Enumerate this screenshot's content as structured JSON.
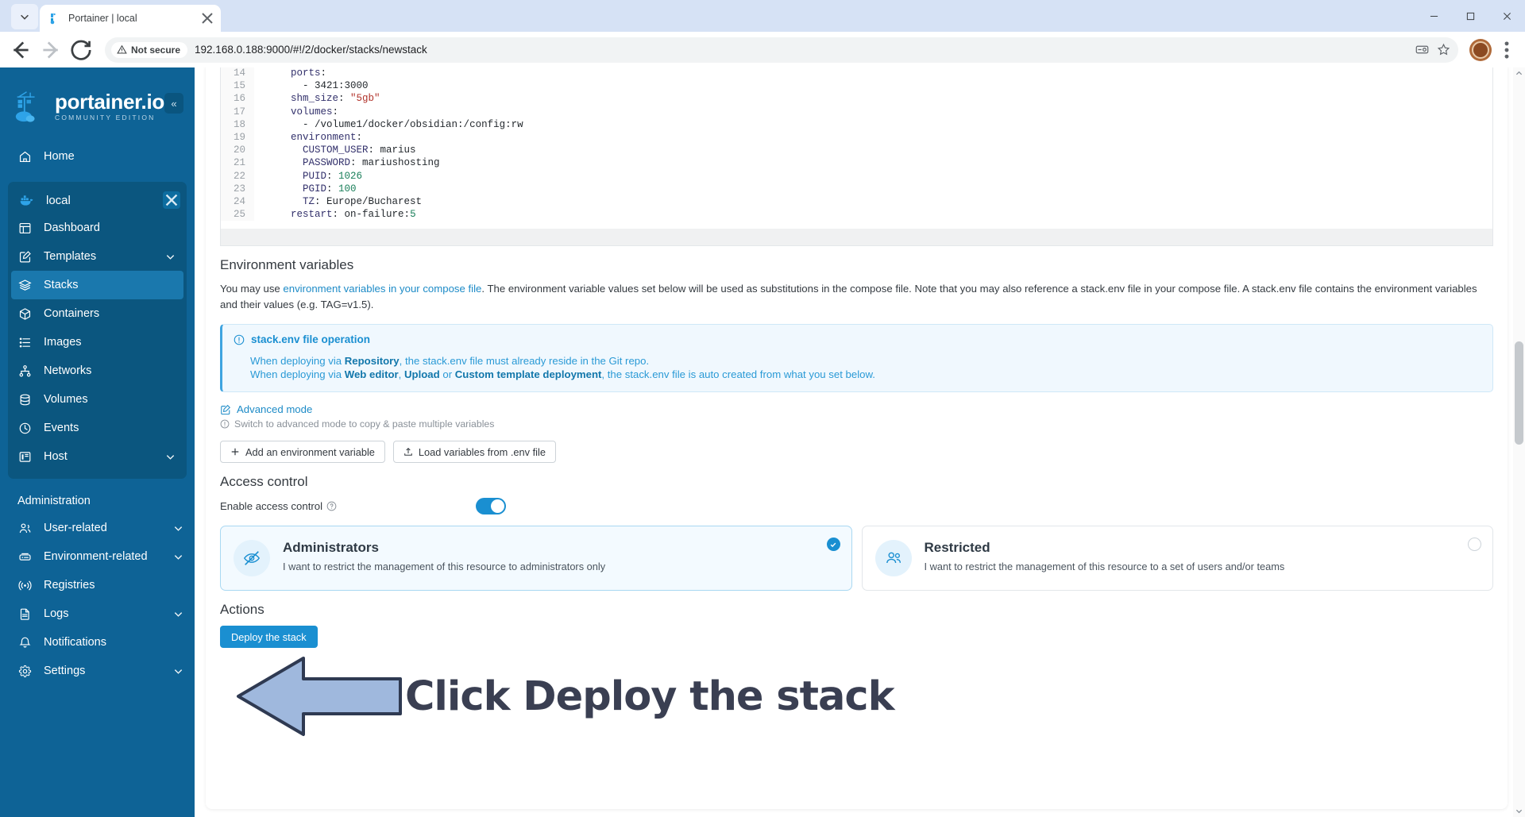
{
  "browser": {
    "tab": {
      "title": "Portainer | local",
      "favicon_icon": "portainer-favicon",
      "close_icon": "close-icon"
    },
    "tab_search_icon": "chevron-down-icon",
    "window_controls": {
      "minimize": "minimize-icon",
      "maximize": "maximize-icon",
      "close": "close-icon"
    },
    "nav": {
      "back_icon": "back-arrow-icon",
      "forward_icon": "forward-arrow-icon",
      "reload_icon": "reload-icon"
    },
    "security_label": "Not secure",
    "security_icon": "warning-triangle-icon",
    "url": "192.168.0.188:9000/#!/2/docker/stacks/newstack",
    "omnibox_icons": [
      "payment-card-icon",
      "bookmark-star-icon"
    ],
    "profile_icon": "avatar",
    "menu_icon": "kebab-menu-icon"
  },
  "sidebar": {
    "logo": {
      "name": "portainer.io",
      "edition": "COMMUNITY EDITION"
    },
    "collapse_label": "«",
    "home": {
      "label": "Home",
      "icon": "home-icon"
    },
    "environment": {
      "name": "local",
      "icon": "docker-whale-icon",
      "close_icon": "close-icon",
      "items": [
        {
          "label": "Dashboard",
          "icon": "dashboard-icon",
          "chevron": false,
          "active": false
        },
        {
          "label": "Templates",
          "icon": "templates-icon",
          "chevron": true,
          "active": false
        },
        {
          "label": "Stacks",
          "icon": "stacks-icon",
          "chevron": false,
          "active": true
        },
        {
          "label": "Containers",
          "icon": "containers-icon",
          "chevron": false,
          "active": false
        },
        {
          "label": "Images",
          "icon": "images-icon",
          "chevron": false,
          "active": false
        },
        {
          "label": "Networks",
          "icon": "networks-icon",
          "chevron": false,
          "active": false
        },
        {
          "label": "Volumes",
          "icon": "volumes-icon",
          "chevron": false,
          "active": false
        },
        {
          "label": "Events",
          "icon": "events-clock-icon",
          "chevron": false,
          "active": false
        },
        {
          "label": "Host",
          "icon": "host-icon",
          "chevron": true,
          "active": false
        }
      ]
    },
    "administration": {
      "title": "Administration",
      "items": [
        {
          "label": "User-related",
          "icon": "users-icon",
          "chevron": true
        },
        {
          "label": "Environment-related",
          "icon": "environment-icon",
          "chevron": true
        },
        {
          "label": "Registries",
          "icon": "registries-icon",
          "chevron": false
        },
        {
          "label": "Logs",
          "icon": "logs-document-icon",
          "chevron": true
        },
        {
          "label": "Notifications",
          "icon": "bell-icon",
          "chevron": false
        },
        {
          "label": "Settings",
          "icon": "gear-icon",
          "chevron": true
        }
      ]
    }
  },
  "editor": {
    "lines": [
      {
        "n": "14",
        "indent": 4,
        "parts": [
          {
            "t": "ports",
            "c": "key"
          },
          {
            "t": ":",
            "c": "pl"
          }
        ]
      },
      {
        "n": "15",
        "indent": 6,
        "parts": [
          {
            "t": "- ",
            "c": "pl"
          },
          {
            "t": "3421:3000",
            "c": "pl"
          }
        ]
      },
      {
        "n": "16",
        "indent": 4,
        "parts": [
          {
            "t": "shm_size",
            "c": "key"
          },
          {
            "t": ": ",
            "c": "pl"
          },
          {
            "t": "\"5gb\"",
            "c": "str"
          }
        ]
      },
      {
        "n": "17",
        "indent": 4,
        "parts": [
          {
            "t": "volumes",
            "c": "key"
          },
          {
            "t": ":",
            "c": "pl"
          }
        ]
      },
      {
        "n": "18",
        "indent": 6,
        "parts": [
          {
            "t": "- ",
            "c": "pl"
          },
          {
            "t": "/volume1/docker/obsidian:/config:rw",
            "c": "pl"
          }
        ]
      },
      {
        "n": "19",
        "indent": 4,
        "parts": [
          {
            "t": "environment",
            "c": "key"
          },
          {
            "t": ":",
            "c": "pl"
          }
        ]
      },
      {
        "n": "20",
        "indent": 6,
        "parts": [
          {
            "t": "CUSTOM_USER",
            "c": "key"
          },
          {
            "t": ": marius",
            "c": "pl"
          }
        ]
      },
      {
        "n": "21",
        "indent": 6,
        "parts": [
          {
            "t": "PASSWORD",
            "c": "key"
          },
          {
            "t": ": mariushosting",
            "c": "pl"
          }
        ]
      },
      {
        "n": "22",
        "indent": 6,
        "parts": [
          {
            "t": "PUID",
            "c": "key"
          },
          {
            "t": ": ",
            "c": "pl"
          },
          {
            "t": "1026",
            "c": "num"
          }
        ]
      },
      {
        "n": "23",
        "indent": 6,
        "parts": [
          {
            "t": "PGID",
            "c": "key"
          },
          {
            "t": ": ",
            "c": "pl"
          },
          {
            "t": "100",
            "c": "num"
          }
        ]
      },
      {
        "n": "24",
        "indent": 6,
        "parts": [
          {
            "t": "TZ",
            "c": "key"
          },
          {
            "t": ": Europe/Bucharest",
            "c": "pl"
          }
        ]
      },
      {
        "n": "25",
        "indent": 4,
        "parts": [
          {
            "t": "restart",
            "c": "key"
          },
          {
            "t": ": on-failure:",
            "c": "pl"
          },
          {
            "t": "5",
            "c": "num"
          }
        ]
      }
    ]
  },
  "env_section": {
    "title": "Environment variables",
    "desc_pre": "You may use ",
    "desc_link": "environment variables in your compose file",
    "desc_post": ". The environment variable values set below will be used as substitutions in the compose file. Note that you may also reference a stack.env file in your compose file. A stack.env file contains the environment variables and their values (e.g. TAG=v1.5).",
    "info": {
      "icon": "info-circle-icon",
      "title": "stack.env file operation",
      "line1": {
        "a": "When deploying via ",
        "b": "Repository",
        "c": ", the stack.env file must already reside in the Git repo."
      },
      "line2": {
        "a": "When deploying via ",
        "b": "Web editor",
        "c": ", ",
        "d": "Upload",
        "e": " or ",
        "f": "Custom template deployment",
        "g": ", the stack.env file is auto created from what you set below."
      }
    },
    "advanced_mode": {
      "label": "Advanced mode",
      "icon": "edit-square-icon"
    },
    "advanced_hint": {
      "label": "Switch to advanced mode to copy & paste multiple variables",
      "icon": "info-circle-icon"
    },
    "buttons": [
      {
        "label": "Add an environment variable",
        "icon": "plus-icon"
      },
      {
        "label": "Load variables from .env file",
        "icon": "upload-icon"
      }
    ]
  },
  "access_control": {
    "title": "Access control",
    "toggle_label": "Enable access control",
    "toggle_help_icon": "question-circle-icon",
    "toggle_on": true,
    "cards": [
      {
        "title": "Administrators",
        "subtitle": "I want to restrict the management of this resource to administrators only",
        "icon": "eye-off-icon",
        "selected": true,
        "check_icon": "check-icon"
      },
      {
        "title": "Restricted",
        "subtitle": "I want to restrict the management of this resource to a set of users and/or teams",
        "icon": "users-group-icon",
        "selected": false,
        "check_icon": "radio-empty-icon"
      }
    ]
  },
  "actions": {
    "title": "Actions",
    "deploy_label": "Deploy the stack"
  },
  "annotation": {
    "text": "Click Deploy the stack",
    "arrow_icon": "left-arrow-annotation",
    "arrow_fill": "#9fb8dd",
    "arrow_stroke": "#2f3a52",
    "text_color": "#3a3f52"
  },
  "colors": {
    "sidebar_bg": "#0e6396",
    "accent": "#1a8fd1",
    "info_bg": "#f0f8fe"
  }
}
